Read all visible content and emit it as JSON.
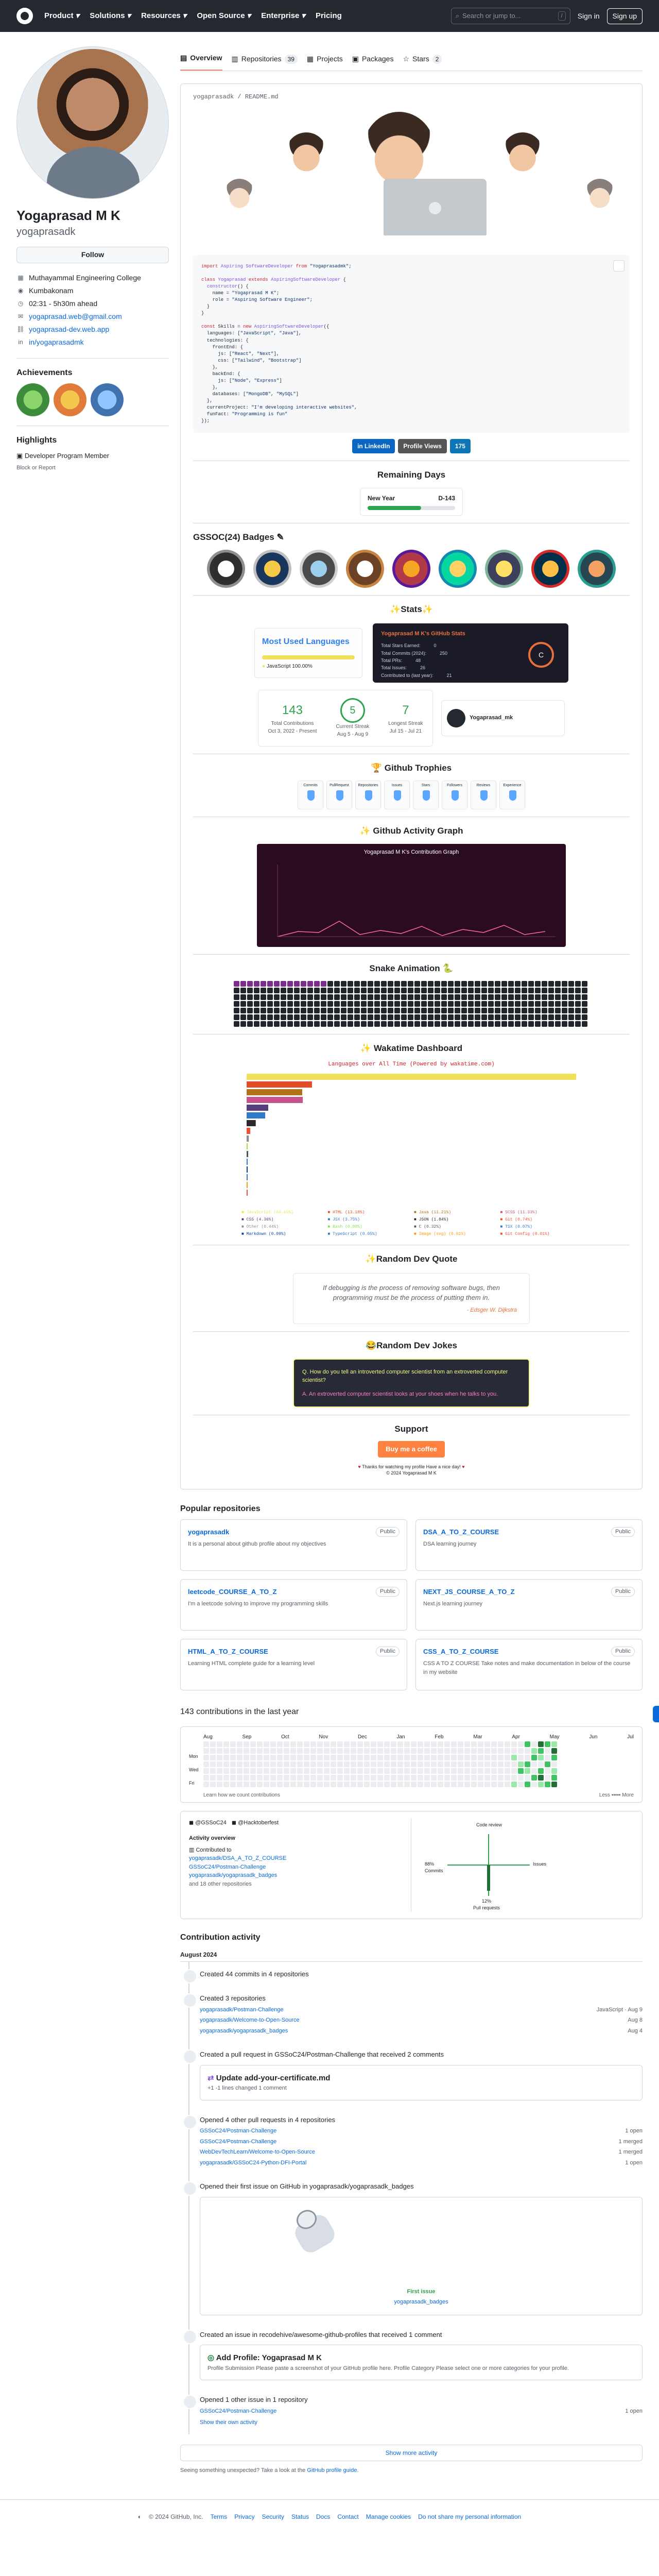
{
  "header": {
    "nav": [
      "Product",
      "Solutions",
      "Resources",
      "Open Source",
      "Enterprise",
      "Pricing"
    ],
    "search_placeholder": "Search or jump to...",
    "search_kbd": "/",
    "sign_in": "Sign in",
    "sign_up": "Sign up"
  },
  "profile": {
    "name": "Yogaprasad M K",
    "login": "yogaprasadk",
    "follow": "Follow",
    "org": "Muthayammal Engineering College",
    "location": "Kumbakonam",
    "local_time": "02:31 - 5h30m ahead",
    "email": "yogaprasad.web@gmail.com",
    "website": "yogaprasad-dev.web.app",
    "social": "in/yogaprasadmk"
  },
  "achievements": {
    "title": "Achievements",
    "x3": "x3",
    "x2": "x2"
  },
  "highlights": {
    "title": "Highlights",
    "item": "Developer Program Member",
    "block": "Block or Report"
  },
  "tabs": [
    {
      "label": "Overview",
      "count": ""
    },
    {
      "label": "Repositories",
      "count": "39"
    },
    {
      "label": "Projects",
      "count": ""
    },
    {
      "label": "Packages",
      "count": ""
    },
    {
      "label": "Stars",
      "count": "2"
    }
  ],
  "readme": {
    "path": "yogaprasadk / README.md",
    "social_links": [
      "in LinkedIn",
      "Profile Views",
      "175"
    ],
    "remaining_days_title": "Remaining Days",
    "new_year_label": "New Year",
    "new_year_days": "D-143",
    "new_year_progress": 0.61,
    "gssoc_title": "GSSOC(24) Badges",
    "stats_title": "Stats",
    "langs_title": "Most Used Languages",
    "langs_item": "JavaScript 100.00%",
    "gstats_title": "Yogaprasad M K's GitHub Stats",
    "gstats_rows": [
      [
        "Total Stars Earned:",
        "0"
      ],
      [
        "Total Commits (2024):",
        "250"
      ],
      [
        "Total PRs:",
        "48"
      ],
      [
        "Total Issues:",
        "26"
      ],
      [
        "Contributed to (last year):",
        "21"
      ]
    ],
    "gstats_grade": "C",
    "streak": {
      "total": "143",
      "total_l": "Total Contributions",
      "total_d": "Oct 3, 2022 - Present",
      "current": "5",
      "current_l": "Current Streak",
      "current_d": "Aug 5 - Aug 9",
      "longest": "7",
      "longest_l": "Longest Streak",
      "longest_d": "Jul 15 - Jul 21"
    },
    "mini_card_user": "Yogaprasad_mk",
    "trophies_title": "Github Trophies",
    "trophies": [
      "Commits",
      "PullRequest",
      "Repositories",
      "Issues",
      "Stars",
      "Followers",
      "Reviews",
      "Experience"
    ],
    "activity_title": "Github Activity Graph",
    "activity_graph_title": "Yogaprasad M K's Contribution Graph",
    "snake_title": "Snake Animation",
    "waka_title": "Wakatime Dashboard",
    "waka_subtitle": "Languages over All Time (Powered by wakatime.com)",
    "waka_langs": [
      "JavaScript (66.45%)",
      "HTML (13.18%)",
      "Java (11.21%)",
      "SCSS (11.33%)",
      "CSS (4.36%)",
      "JSX (3.75%)",
      "JSON (1.84%)",
      "Git (0.74%)",
      "Other (0.44%)",
      "Bash (0.00%)",
      "C (0.32%)",
      "TSX (0.07%)",
      "Markdown (0.09%)",
      "TypeScript (0.05%)",
      "Image (svg) (0.01%)",
      "Git Config (0.01%)"
    ],
    "quote_title": "Random Dev Quote",
    "quote": "If debugging is the process of removing software bugs, then programming must be the process of putting them in.",
    "quote_author": "- Edsger W. Dijkstra",
    "joke_title": "Random Dev Jokes",
    "joke_q": "Q. How do you tell an introverted computer scientist from an extroverted computer scientist?",
    "joke_a": "A. An extroverted computer scientist looks at your shoes when he talks to you.",
    "support_title": "Support",
    "coffee": "Buy me a coffee",
    "thanks": "Thanks for watching my profile Have a nice day!",
    "copyright": "© 2024 Yogaprasad M K"
  },
  "popular": {
    "title": "Popular repositories",
    "repos": [
      {
        "name": "yogaprasadk",
        "badge": "Public",
        "desc": "It is a personal about github profile about my objectives"
      },
      {
        "name": "DSA_A_TO_Z_COURSE",
        "badge": "Public",
        "desc": "DSA learning journey"
      },
      {
        "name": "leetcode_COURSE_A_TO_Z",
        "badge": "Public",
        "desc": "I'm a leetcode solving to improve my programming skills"
      },
      {
        "name": "NEXT_JS_COURSE_A_TO_Z",
        "badge": "Public",
        "desc": "Next.js learning journey"
      },
      {
        "name": "HTML_A_TO_Z_COURSE",
        "badge": "Public",
        "desc": "Learning HTML complete guide for a learning level"
      },
      {
        "name": "CSS_A_TO_Z_COURSE",
        "badge": "Public",
        "desc": "CSS A TO Z COURSE Take notes and make documentation in below of the course in my website"
      }
    ]
  },
  "contrib": {
    "title": "143 contributions in the last year",
    "year": "2024",
    "months": [
      "Aug",
      "Sep",
      "Oct",
      "Nov",
      "Dec",
      "Jan",
      "Feb",
      "Mar",
      "Apr",
      "May",
      "Jun",
      "Jul"
    ],
    "days": [
      "Mon",
      "Wed",
      "Fri"
    ],
    "learn": "Learn how we count contributions",
    "less": "Less",
    "more": "More",
    "orgs": [
      "@GSSoC24",
      "@Hacktoberfest"
    ],
    "activity_overview": "Activity overview",
    "contributed_to": "Contributed to",
    "contributed_repos": [
      "yogaprasadk/DSA_A_TO_Z_COURSE",
      "GSSoC24/Postman-Challenge",
      "yogaprasadk/yogaprasadk_badges"
    ],
    "and_more": "and 18 other repositories",
    "axis": {
      "top": "Code review",
      "left": "Commits",
      "right": "Issues",
      "bottom": "Pull requests",
      "commits_pct": "88%",
      "prs_pct": "12%"
    }
  },
  "activity": {
    "title": "Contribution activity",
    "month": "August 2024",
    "items": [
      {
        "text": "Created 44 commits in 4 repositories",
        "subs": []
      },
      {
        "text": "Created 3 repositories",
        "subs": [
          [
            "yogaprasadk/Postman-Challenge",
            "JavaScript · Aug 9"
          ],
          [
            "yogaprasadk/Welcome-to-Open-Source",
            "Aug 8"
          ],
          [
            "yogaprasadk/yogaprasadk_badges",
            "Aug 4"
          ]
        ]
      },
      {
        "text": "Created a pull request in GSSoC24/Postman-Challenge that received 2 comments",
        "subs": []
      },
      {
        "text": "Opened 4 other pull requests in 4 repositories",
        "subs": [
          [
            "GSSoC24/Postman-Challenge",
            "1 open"
          ],
          [
            "GSSoC24/Postman-Challenge",
            "1 merged"
          ],
          [
            "WebDevTechLearn/Welcome-to-Open-Source",
            "1 merged"
          ],
          [
            "yogaprasadk/GSSoC24-Python-DFI-Portal",
            "1 open"
          ]
        ]
      },
      {
        "text": "Opened their first issue on GitHub in yogaprasadk/yogaprasadk_badges",
        "subs": []
      },
      {
        "text": "Created an issue in recodehive/awesome-github-profiles that received 1 comment",
        "subs": []
      },
      {
        "text": "Opened 1 other issue in 1 repository",
        "subs": [
          [
            "GSSoC24/Postman-Challenge",
            "1 open"
          ]
        ]
      }
    ],
    "pr_card_title": "Update add-your-certificate.md",
    "pr_card_meta": "+1  -1  lines changed  1 comment",
    "first_issue_label": "First issue",
    "first_issue_link": "yogaprasadk_badges",
    "issue_card_title": "Add Profile: Yogaprasad M K",
    "issue_card_body": "Profile Submission Please paste a screenshot of your GitHub profile here. Profile Category Please select one or more categories for your profile.",
    "show_own": "Show their own activity",
    "show_more": "Show more activity",
    "seeing": "Seeing something unexpected? Take a look at the",
    "profile_guide": "GitHub profile guide."
  },
  "footer": [
    "© 2024 GitHub, Inc.",
    "Terms",
    "Privacy",
    "Security",
    "Status",
    "Docs",
    "Contact",
    "Manage cookies",
    "Do not share my personal information"
  ]
}
